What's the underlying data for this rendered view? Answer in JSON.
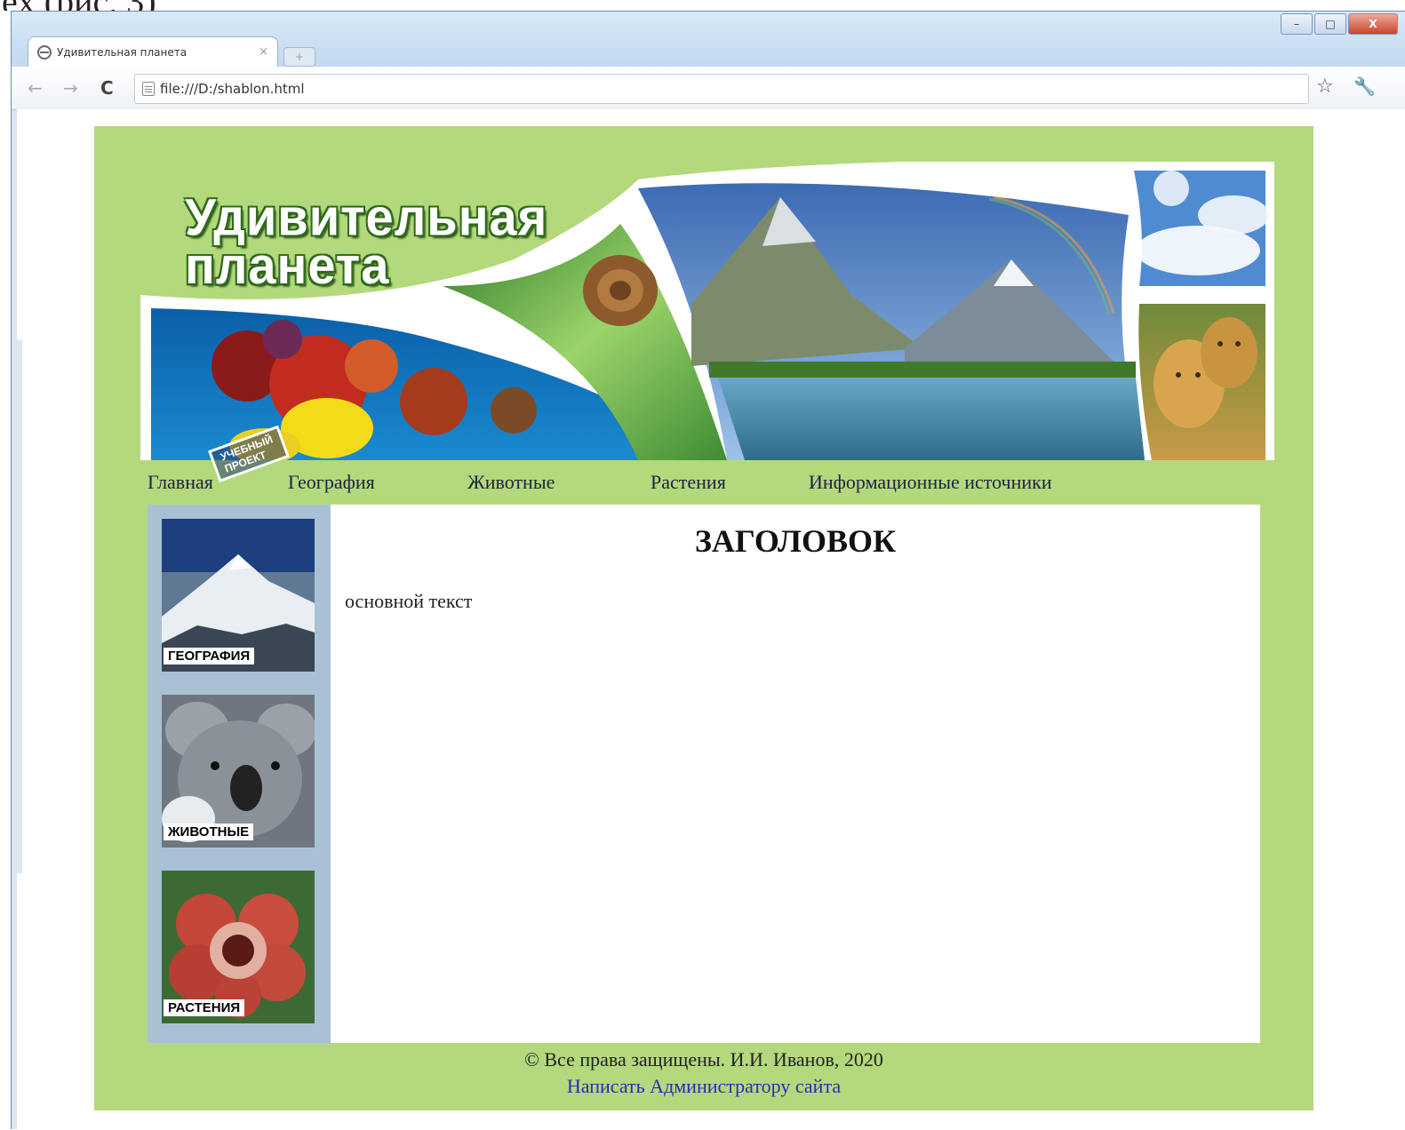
{
  "page_caption_clip": "ex (рис. 3)",
  "window": {
    "controls": {
      "minimize": "–",
      "maximize": "□",
      "close": "X"
    }
  },
  "tab": {
    "title": "Удивительная планета",
    "close": "×",
    "favicon": "globe-icon"
  },
  "toolbar": {
    "back": "←",
    "forward": "→",
    "reload": "C",
    "url": "file:///D:/shablon.html",
    "star": "☆",
    "wrench": "🔧"
  },
  "site": {
    "logo_line1": "Удивительная",
    "logo_line2": "планета",
    "stamp_line1": "УЧЕБНЫЙ",
    "stamp_line2": "ПРОЕКТ",
    "menu": [
      {
        "label": "Главная"
      },
      {
        "label": "География"
      },
      {
        "label": "Животные"
      },
      {
        "label": "Растения"
      },
      {
        "label": "Информационные источники"
      }
    ],
    "sidebar": [
      {
        "label": "ГЕОГРАФИЯ",
        "icon": "mountain-image"
      },
      {
        "label": "ЖИВОТНЫЕ",
        "icon": "koala-image"
      },
      {
        "label": "РАСТЕНИЯ",
        "icon": "flower-image"
      }
    ],
    "heading": "ЗАГОЛОВОК",
    "body_text": "основной текст",
    "footer_copy": "© Все права защищены. И.И. Иванов, 2020",
    "footer_link": "Написать Администратору сайта"
  },
  "colors": {
    "site_bg": "#b3d97c",
    "sidebar_bg": "#a9c1d4",
    "link": "#2a2ab8"
  }
}
